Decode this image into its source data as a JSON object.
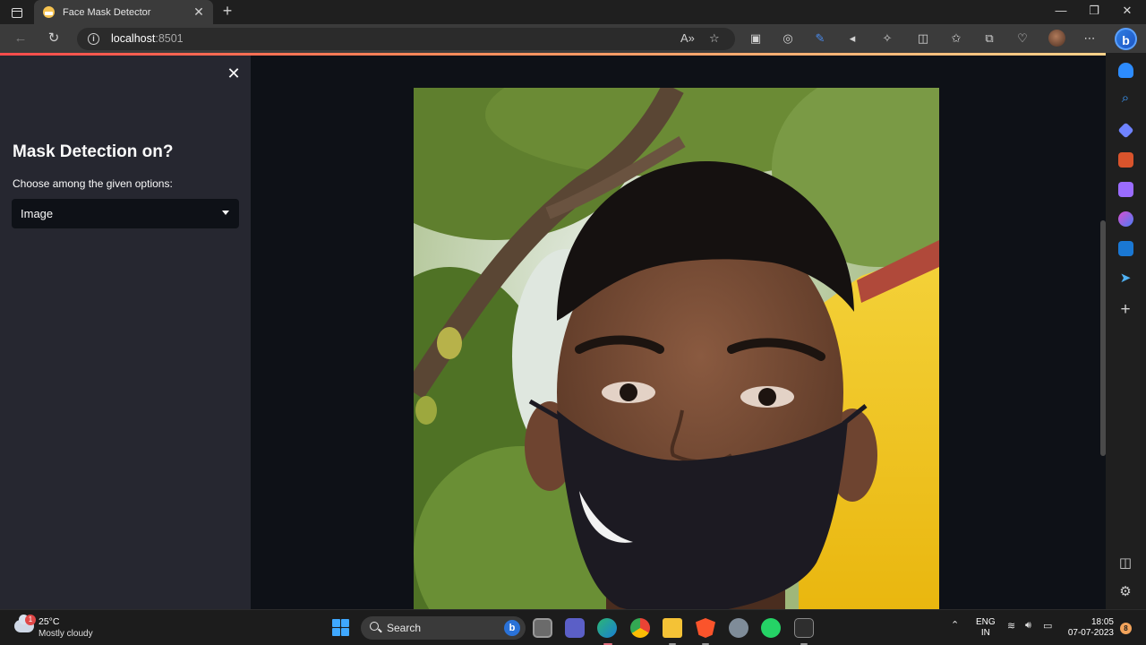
{
  "browser": {
    "tab_title": "Face Mask Detector",
    "url_host": "localhost",
    "url_port": ":8501",
    "icons": [
      "back-icon",
      "refresh-icon",
      "info-icon",
      "read-aloud-icon",
      "favorite-star-icon",
      "extension-icon",
      "split-screen-icon",
      "favorites-icon",
      "collections-icon",
      "browser-essentials-icon",
      "more-icon",
      "bing-chat-icon"
    ]
  },
  "sidebar": {
    "heading": "Mask Detection on?",
    "help_text": "Choose among the given options:",
    "select": {
      "value": "Image"
    }
  },
  "main": {
    "image_description_icon": "photo-person-with-mask"
  },
  "edge_sidebar": {
    "icons": [
      "notification-bell-icon",
      "search-icon",
      "shopping-tag-icon",
      "tools-briefcase-icon",
      "games-icon",
      "office-icon",
      "outlook-icon",
      "telegram-icon",
      "add-icon",
      "hide-sidebar-icon",
      "settings-icon"
    ]
  },
  "taskbar": {
    "weather_temp": "25°C",
    "weather_text": "Mostly cloudy",
    "weather_badge": "1",
    "search_label": "Search",
    "language_line1": "ENG",
    "language_line2": "IN",
    "time": "18:05",
    "date": "07-07-2023",
    "notification_count": "8"
  },
  "colors": {
    "app_bg": "#0e1117",
    "sidebar_bg": "#262730",
    "accent": "#ff4b4b"
  }
}
